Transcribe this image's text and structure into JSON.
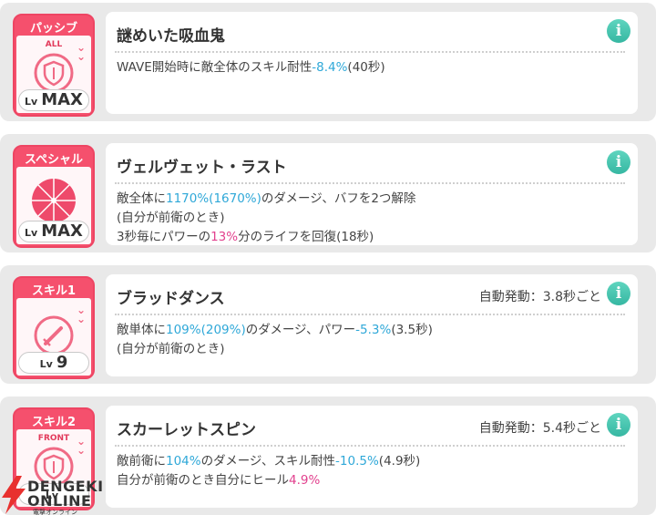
{
  "skills": [
    {
      "category": "パッシブ",
      "scope": "ALL",
      "level_prefix": "Lv",
      "level": "MAX",
      "icon": "shield-icon",
      "name": "謎めいた吸血鬼",
      "auto": "",
      "desc": [
        [
          {
            "t": "WAVE開始時に敵全体のスキル耐性"
          },
          {
            "t": "-8.4%",
            "c": "blue"
          },
          {
            "t": "(40秒)"
          }
        ]
      ]
    },
    {
      "category": "スペシャル",
      "scope": "",
      "level_prefix": "Lv",
      "level": "MAX",
      "icon": "umbrella-icon",
      "name": "ヴェルヴェット・ラスト",
      "auto": "",
      "desc": [
        [
          {
            "t": "敵全体に"
          },
          {
            "t": "1170%(1670%)",
            "c": "blue"
          },
          {
            "t": "のダメージ、バフを2つ解除"
          }
        ],
        [
          {
            "t": "(自分が前衛のとき)"
          }
        ],
        [
          {
            "t": "3秒毎にパワーの"
          },
          {
            "t": "13%",
            "c": "pink"
          },
          {
            "t": "分のライフを回復(18秒)"
          }
        ]
      ]
    },
    {
      "category": "スキル1",
      "scope": "",
      "level_prefix": "Lv",
      "level": "9",
      "icon": "sword-icon",
      "name": "ブラッドダンス",
      "auto": "自動発動：3.8秒ごと",
      "desc": [
        [
          {
            "t": "敵単体に"
          },
          {
            "t": "109%(209%)",
            "c": "blue"
          },
          {
            "t": "のダメージ、パワー"
          },
          {
            "t": "-5.3%",
            "c": "blue"
          },
          {
            "t": "(3.5秒)"
          }
        ],
        [
          {
            "t": "(自分が前衛のとき)"
          }
        ]
      ]
    },
    {
      "category": "スキル2",
      "scope": "FRONT",
      "level_prefix": "Lv",
      "level": "",
      "icon": "shield-icon",
      "name": "スカーレットスピン",
      "auto": "自動発動：5.4秒ごと",
      "desc": [
        [
          {
            "t": "敵前衛に"
          },
          {
            "t": "104%",
            "c": "blue"
          },
          {
            "t": "のダメージ、スキル耐性"
          },
          {
            "t": "-10.5%",
            "c": "blue"
          },
          {
            "t": "(4.9秒)"
          }
        ],
        [
          {
            "t": "自分が前衛のとき自分にヒール"
          },
          {
            "t": "4.9%",
            "c": "pink"
          }
        ]
      ]
    }
  ],
  "info_glyph": "i",
  "watermark": {
    "line1": "DENGEKI",
    "line2": "ONLINE",
    "line3": "電撃オンライン"
  },
  "colors": {
    "accent_blue": "#2fa8d8",
    "accent_pink": "#e2418e",
    "badge_red": "#f5506d",
    "info_teal": "#3cbfa9"
  }
}
